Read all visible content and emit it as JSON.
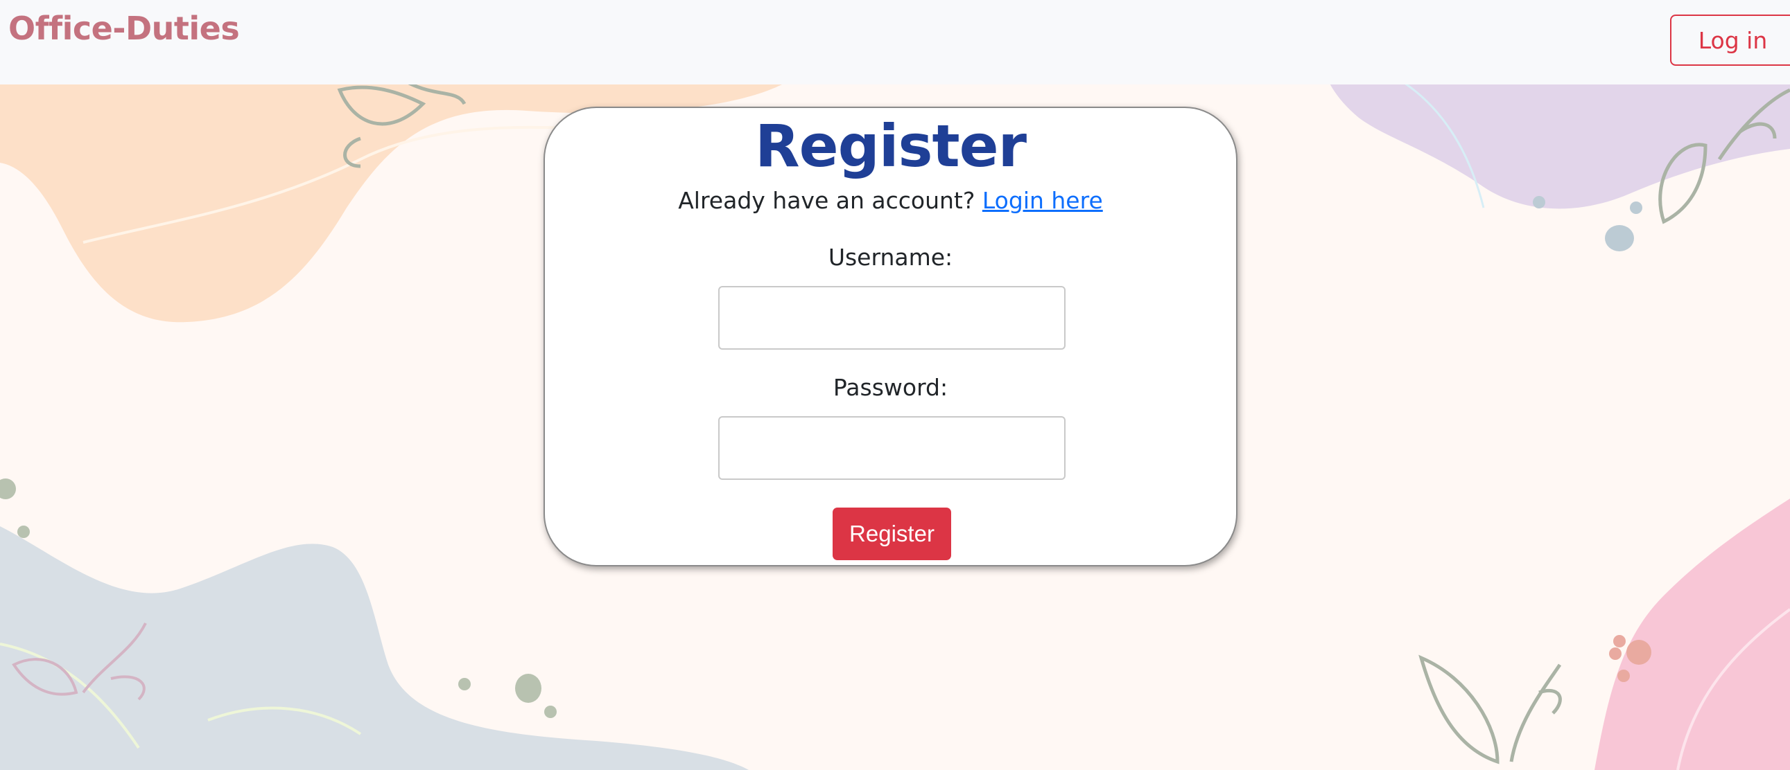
{
  "navbar": {
    "brand": "Office-Duties",
    "login_button": "Log in"
  },
  "form": {
    "title": "Register",
    "account_prompt": "Already have an account?",
    "login_link": "Login here",
    "username_label": "Username:",
    "username_value": "",
    "password_label": "Password:",
    "password_value": "",
    "submit_label": "Register"
  },
  "colors": {
    "brand": "#c4727f",
    "accent_red": "#dc3545",
    "title_blue": "#1f3f96",
    "link_blue": "#0d6efd"
  }
}
